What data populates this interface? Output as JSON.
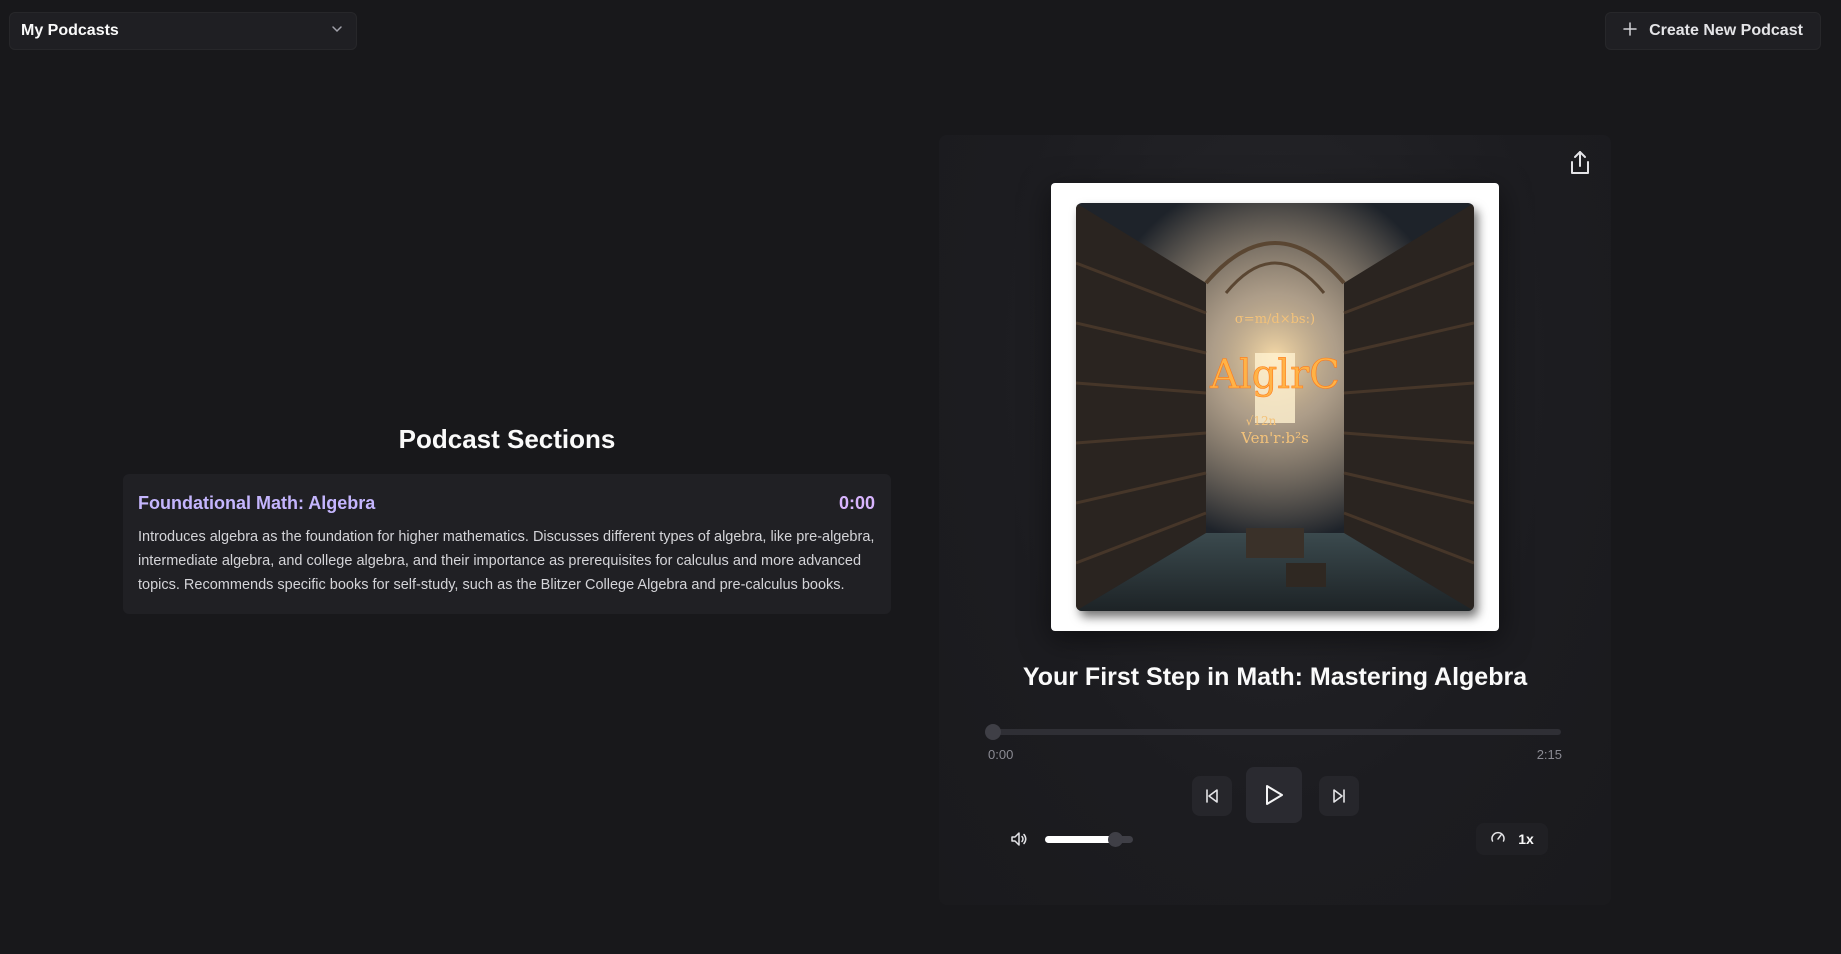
{
  "topbar": {
    "podcast_select": {
      "label": "My Podcasts",
      "icon": "chevron-down-icon"
    },
    "create_button": {
      "label": "Create New Podcast",
      "icon": "plus-icon"
    }
  },
  "sections": {
    "heading": "Podcast Sections",
    "items": [
      {
        "title": "Foundational Math: Algebra",
        "time": "0:00",
        "description": "Introduces algebra as the foundation for higher mathematics. Discusses different types of algebra, like pre-algebra, intermediate algebra, and college algebra, and their importance as prerequisites for calculus and more advanced topics. Recommends specific books for self-study, such as the Blitzer College Algebra and pre-calculus books."
      }
    ]
  },
  "player": {
    "share_icon": "share-icon",
    "cover": {
      "title_text": "AlglrC",
      "formula_top": "σ=m/d×bs:)",
      "formula_bottom": "Ven'r:b²s",
      "formula_mid": "√12n"
    },
    "episode_title": "Your First Step in Math: Mastering Algebra",
    "progress": {
      "current": "0:00",
      "total": "2:15",
      "fraction": 0.0
    },
    "controls": {
      "prev_icon": "skip-back-icon",
      "play_icon": "play-icon",
      "next_icon": "skip-forward-icon"
    },
    "volume": {
      "icon": "volume-icon",
      "level": 0.8
    },
    "speed": {
      "icon": "gauge-icon",
      "label": "1x"
    }
  },
  "colors": {
    "background": "#18181b",
    "accent_title": "#c4b5fd",
    "accent_time": "#d8b4fe"
  }
}
